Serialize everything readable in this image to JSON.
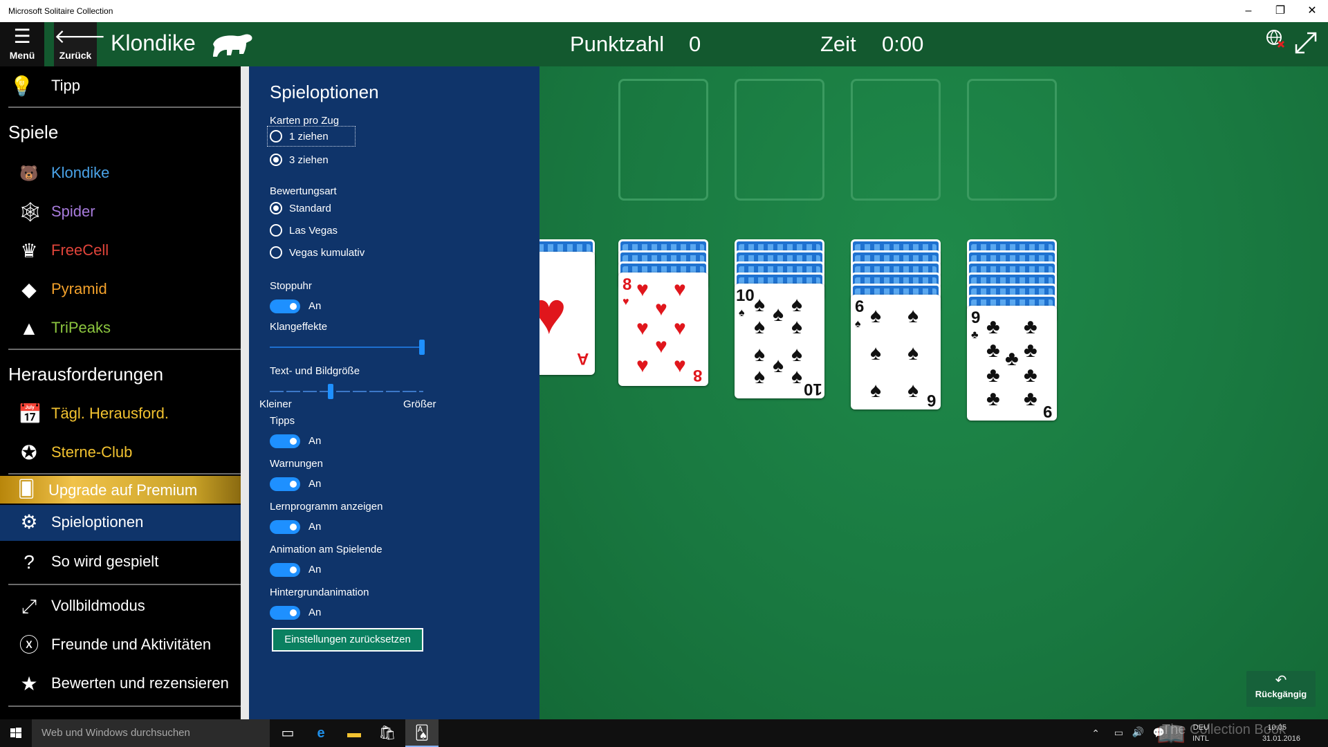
{
  "window": {
    "title": "Microsoft Solitaire Collection",
    "controls": {
      "minimize": "–",
      "restore": "❐",
      "close": "✕"
    }
  },
  "header": {
    "menu_label": "Menü",
    "back_label": "Zurück",
    "game_title": "Klondike",
    "score_label": "Punktzahl",
    "score_value": "0",
    "time_label": "Zeit",
    "time_value": "0:00"
  },
  "menu": {
    "hint": "Tipp",
    "games_heading": "Spiele",
    "games": [
      {
        "label": "Klondike",
        "color": "#4aa3e8",
        "icon": "bear-icon"
      },
      {
        "label": "Spider",
        "color": "#a77bdc",
        "icon": "spider-icon"
      },
      {
        "label": "FreeCell",
        "color": "#e0443a",
        "icon": "crown-icon"
      },
      {
        "label": "Pyramid",
        "color": "#f2a12b",
        "icon": "pyramid-icon"
      },
      {
        "label": "TriPeaks",
        "color": "#8cc63f",
        "icon": "peaks-icon"
      }
    ],
    "challenges_heading": "Herausforderungen",
    "challenges": [
      {
        "label": "Tägl. Herausford.",
        "color": "#f2c230",
        "icon": "calendar-icon"
      },
      {
        "label": "Sterne-Club",
        "color": "#f2c230",
        "icon": "star-club-icon"
      }
    ],
    "premium": "Upgrade auf Premium",
    "options": "Spieloptionen",
    "howto": "So wird gespielt",
    "fullscreen": "Vollbildmodus",
    "friends": "Freunde und Aktivitäten",
    "rate": "Bewerten und rezensieren"
  },
  "options": {
    "title": "Spieloptionen",
    "draw_label": "Karten pro Zug",
    "draw_options": [
      "1 ziehen",
      "3 ziehen"
    ],
    "draw_selected": "3 ziehen",
    "scoring_label": "Bewertungsart",
    "scoring_options": [
      "Standard",
      "Las Vegas",
      "Vegas kumulativ"
    ],
    "scoring_selected": "Standard",
    "stopwatch_label": "Stoppuhr",
    "stopwatch_state": "An",
    "sound_label": "Klangeffekte",
    "sound_level": 1.0,
    "size_label": "Text- und Bildgröße",
    "size_level": 0.4,
    "size_min": "Kleiner",
    "size_max": "Größer",
    "tips_label": "Tipps",
    "tips_state": "An",
    "warnings_label": "Warnungen",
    "warnings_state": "An",
    "tutorial_label": "Lernprogramm anzeigen",
    "tutorial_state": "An",
    "endanim_label": "Animation am Spielende",
    "endanim_state": "An",
    "bganim_label": "Hintergrundanimation",
    "bganim_state": "An",
    "reset_label": "Einstellungen zurücksetzen"
  },
  "board": {
    "undo_label": "Rückgängig",
    "tableau": [
      {
        "rank": "A",
        "suit": "♥",
        "hidden": 1
      },
      {
        "rank": "8",
        "suit": "♥",
        "hidden": 3
      },
      {
        "rank": "10",
        "suit": "♠",
        "hidden": 4
      },
      {
        "rank": "6",
        "suit": "♠",
        "hidden": 5
      },
      {
        "rank": "9",
        "suit": "♣",
        "hidden": 6
      }
    ]
  },
  "taskbar": {
    "search_placeholder": "Web und Windows durchsuchen",
    "lang": "DEU",
    "layout": "INTL",
    "time": "10:05",
    "date": "31.01.2016",
    "watermark": "The Collection Book"
  }
}
